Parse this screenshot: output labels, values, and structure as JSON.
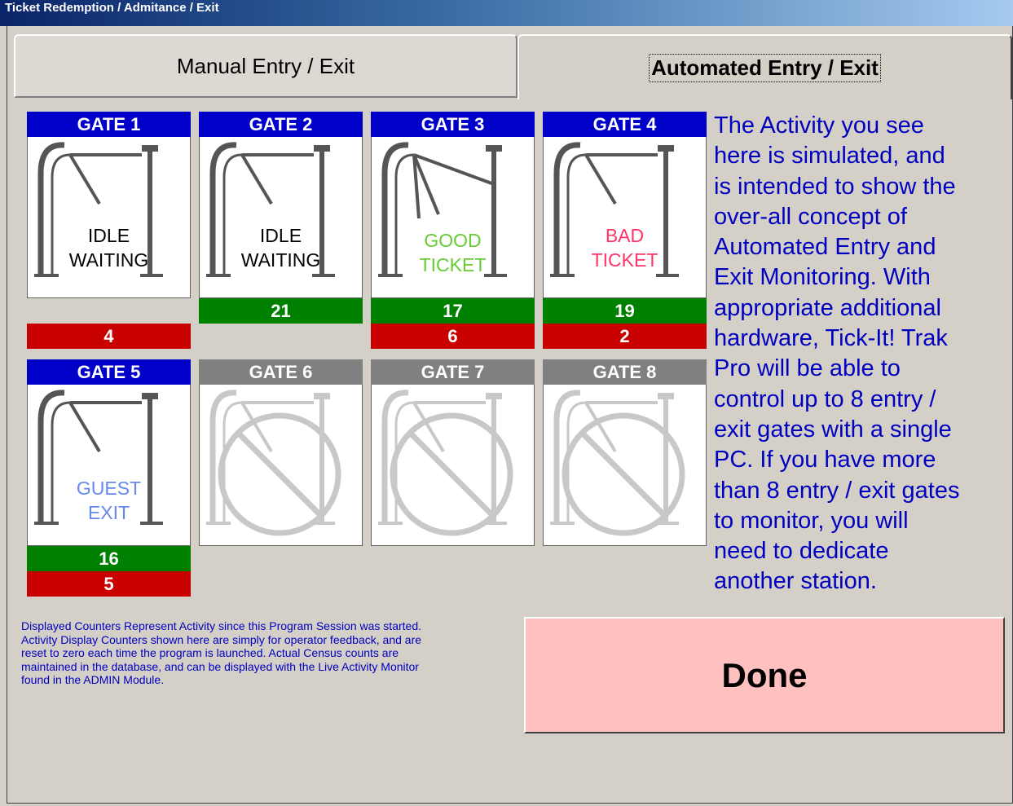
{
  "window": {
    "title": "Ticket Redemption / Admitance / Exit"
  },
  "tabs": [
    {
      "label": "Manual Entry / Exit",
      "active": false
    },
    {
      "label": "Automated Entry / Exit",
      "active": true
    }
  ],
  "gates": [
    {
      "label": "GATE 1",
      "enabled": true,
      "status": [
        "IDLE",
        "WAITING"
      ],
      "status_color": "#000000",
      "good_count": null,
      "bad_count": "4"
    },
    {
      "label": "GATE 2",
      "enabled": true,
      "status": [
        "IDLE",
        "WAITING"
      ],
      "status_color": "#000000",
      "good_count": "21",
      "bad_count": null
    },
    {
      "label": "GATE 3",
      "enabled": true,
      "status": [
        "GOOD",
        "TICKET"
      ],
      "status_color": "#66cc33",
      "good_count": "17",
      "bad_count": "6"
    },
    {
      "label": "GATE 4",
      "enabled": true,
      "status": [
        "BAD",
        "TICKET"
      ],
      "status_color": "#ff3366",
      "good_count": "19",
      "bad_count": "2"
    },
    {
      "label": "GATE 5",
      "enabled": true,
      "status": [
        "GUEST",
        "EXIT"
      ],
      "status_color": "#6688ee",
      "good_count": "16",
      "bad_count": "5"
    },
    {
      "label": "GATE 6",
      "enabled": false,
      "status": [],
      "good_count": null,
      "bad_count": null
    },
    {
      "label": "GATE 7",
      "enabled": false,
      "status": [],
      "good_count": null,
      "bad_count": null
    },
    {
      "label": "GATE 8",
      "enabled": false,
      "status": [],
      "good_count": null,
      "bad_count": null
    }
  ],
  "info_text": "The Activity you see\nhere is simulated, and\nis intended to show the\nover-all concept of\nAutomated Entry and\nExit Monitoring.  With\nappropriate additional\nhardware, Tick-It! Trak\nPro will be able to\ncontrol up to 8 entry /\nexit gates with a single\nPC.  If you have more\nthan 8 entry / exit gates\nto monitor, you will\nneed to dedicate\nanother station.",
  "footnote": "Displayed Counters Represent Activity since this Program Session was started.\nActivity Display Counters shown here are simply for operator feedback, and are\nreset to zero each time the program is launched.  Actual Census counts are\nmaintained in the database, and can be displayed with the Live Activity Monitor\nfound in the ADMIN Module.",
  "done_button": {
    "label": "Done"
  },
  "colors": {
    "gate_enabled": "#0000c8",
    "gate_disabled": "#808080",
    "good": "#008000",
    "bad": "#c80000",
    "text_blue": "#0000c0",
    "done_bg": "#ffc0c0"
  }
}
